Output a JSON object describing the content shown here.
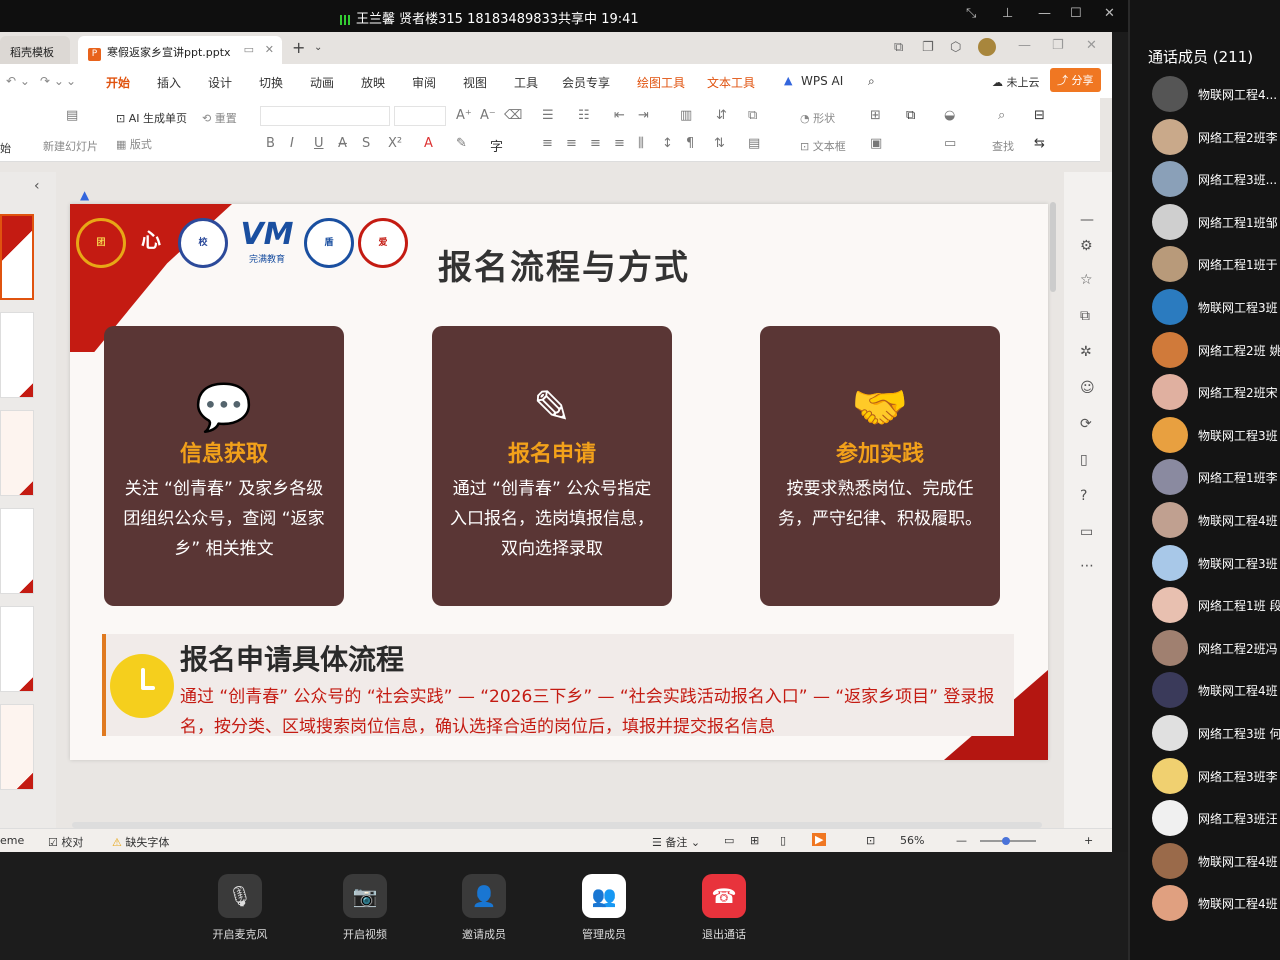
{
  "share": {
    "text": "王兰馨 贤者楼315 18183489833共享中 19:41"
  },
  "tabs": {
    "template_tab": "稻壳模板",
    "doc_tab": "寒假返家乡宣讲ppt.pptx",
    "doc_badge": "P"
  },
  "menu": [
    "开始",
    "插入",
    "设计",
    "切换",
    "动画",
    "放映",
    "审阅",
    "视图",
    "工具",
    "会员专享",
    "绘图工具",
    "文本工具",
    "WPS AI"
  ],
  "menu_right": {
    "cloud": "未上云",
    "share": "分享"
  },
  "ribbon": {
    "ai_single": "AI 生成单页",
    "reset": "重置",
    "new_slide": "新建幻灯片",
    "layout": "版式",
    "start": "始",
    "shape": "形状",
    "textbox": "文本框",
    "find": "查找"
  },
  "slide": {
    "title": "报名流程与方式",
    "logos": [
      "团",
      "心",
      "校",
      "VM",
      "盾",
      "爱"
    ],
    "vm_text": "完满教育",
    "cards": [
      {
        "icon": "💬",
        "title": "信息获取",
        "text": "关注 “创青春” 及家乡各级团组织公众号，查阅 “返家乡” 相关推文"
      },
      {
        "icon": "✎",
        "title": "报名申请",
        "text": "通过 “创青春” 公众号指定入口报名，选岗填报信息，双向选择录取"
      },
      {
        "icon": "🤝",
        "title": "参加实践",
        "text": "按要求熟悉岗位、完成任务，严守纪律、积极履职。"
      }
    ],
    "process_title": "报名申请具体流程",
    "process_text": "通过 “创青春” 公众号的 “社会实践” — “2026三下乡” — “社会实践活动报名入口” — “返家乡项目” 登录报名，按分类、区域搜索岗位信息，确认选择合适的岗位后，填报并提交报名信息"
  },
  "status": {
    "theme": "eme",
    "proof": "校对",
    "missing_font": "缺失字体",
    "notes": "备注",
    "zoom": "56%"
  },
  "controls": [
    {
      "icon": "🎙",
      "label": "开启麦克风"
    },
    {
      "icon": "📷",
      "label": "开启视频"
    },
    {
      "icon": "👤",
      "label": "邀请成员"
    },
    {
      "icon": "👥",
      "label": "管理成员"
    },
    {
      "icon": "☎",
      "label": "退出通话"
    }
  ],
  "members_title": "通话成员 (211)",
  "members": [
    "物联网工程4...",
    "网络工程2班李",
    "网络工程3班...",
    "网络工程1班邹",
    "网络工程1班于",
    "物联网工程3班",
    "网络工程2班 姚",
    "网络工程2班宋",
    "物联网工程3班",
    "网络工程1班李",
    "物联网工程4班",
    "物联网工程3班",
    "网络工程1班 段",
    "网络工程2班冯",
    "物联网工程4班",
    "网络工程3班 何",
    "网络工程3班李",
    "网络工程3班汪",
    "物联网工程4班",
    "物联网工程4班"
  ],
  "colors": {
    "accent": "#e0530f",
    "card": "#5a3635",
    "card_title": "#f2a11a",
    "slide_red": "#c41b12",
    "end_call": "#e8333c"
  }
}
